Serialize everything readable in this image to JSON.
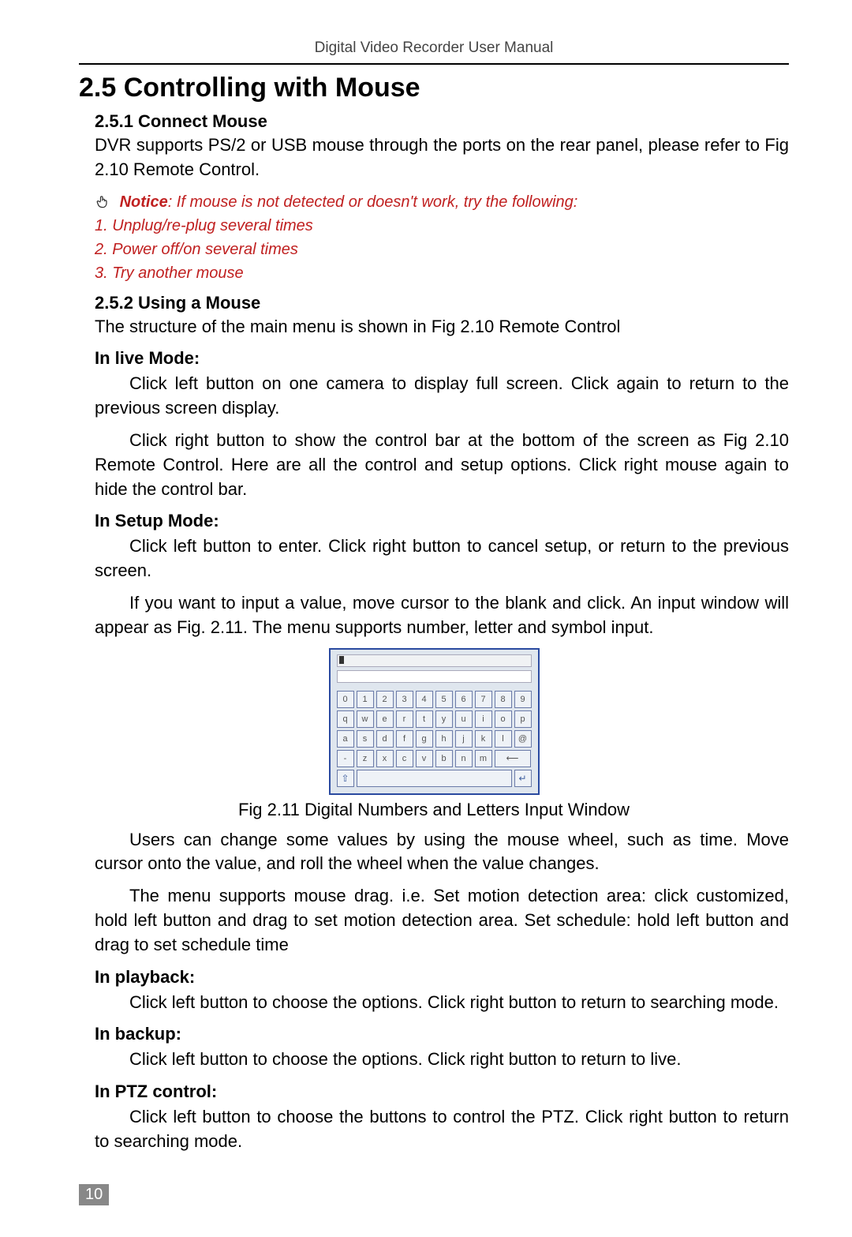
{
  "header": {
    "title": "Digital Video Recorder User Manual"
  },
  "section": {
    "number_title": "2.5  Controlling with Mouse",
    "sub1": {
      "heading": "2.5.1  Connect Mouse",
      "para": "DVR supports PS/2 or USB mouse through the ports on the rear panel, please refer to Fig 2.10 Remote Control."
    },
    "notice": {
      "label": "Notice",
      "rest": ": If mouse is not detected or doesn't work, try the following:",
      "items": [
        "1. Unplug/re-plug several times",
        "2. Power off/on several times",
        "3. Try another mouse"
      ]
    },
    "sub2": {
      "heading": "2.5.2  Using a Mouse",
      "intro": "The structure of the main menu is shown in Fig 2.10 Remote Control",
      "live_heading": "In live Mode:",
      "live_p1": "Click left button on one camera to display full screen. Click again to return to the previous screen display.",
      "live_p2": "Click right button to show the control bar at the bottom of the screen as Fig 2.10 Remote Control. Here are all the control and setup options. Click right mouse again to hide the control bar.",
      "setup_heading": "In Setup Mode:",
      "setup_p1": "Click left button to enter. Click right button to cancel setup, or return to the previous screen.",
      "setup_p2": "If you want to input a value, move cursor to the blank and click. An input window will appear as Fig. 2.11. The menu supports number, letter and symbol input.",
      "fig_caption": "Fig 2.11 Digital Numbers and Letters Input Window",
      "after_fig_p1": "Users can change some values by using the mouse wheel, such as time. Move cursor onto the value, and roll the wheel when the value changes.",
      "after_fig_p2": "The menu supports mouse drag. i.e. Set motion detection area: click customized, hold left button and drag to set motion detection area. Set schedule: hold left button and drag to set schedule time",
      "playback_heading": "In playback:",
      "playback_p": "Click left button to choose the options. Click right button to return to searching mode.",
      "backup_heading": "In backup:",
      "backup_p": "Click left button to choose the options. Click right button to return to live.",
      "ptz_heading": "In PTZ control:",
      "ptz_p": "Click left button to choose the buttons to control the PTZ. Click right button to return to searching mode."
    }
  },
  "keyboard": {
    "row1": [
      "0",
      "1",
      "2",
      "3",
      "4",
      "5",
      "6",
      "7",
      "8",
      "9"
    ],
    "row2": [
      "q",
      "w",
      "e",
      "r",
      "t",
      "y",
      "u",
      "i",
      "o",
      "p"
    ],
    "row3": [
      "a",
      "s",
      "d",
      "f",
      "g",
      "h",
      "j",
      "k",
      "l",
      "@"
    ],
    "row4": [
      "-",
      "z",
      "x",
      "c",
      "v",
      "b",
      "n",
      "m"
    ],
    "backspace_glyph": "⟵",
    "shift_glyph": "⇧",
    "enter_glyph": "↵"
  },
  "page_number": "10"
}
